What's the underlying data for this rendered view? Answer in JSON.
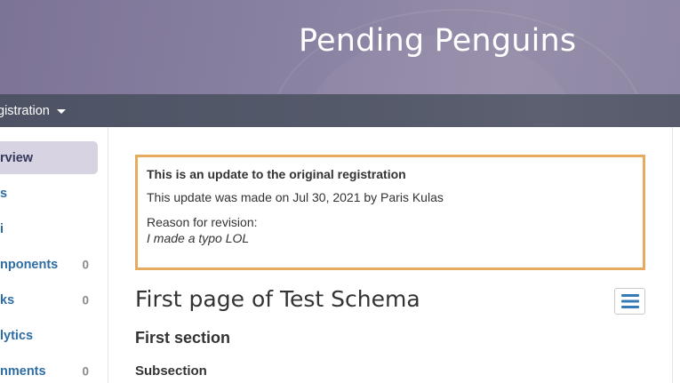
{
  "header": {
    "title": "Pending Penguins"
  },
  "navbar": {
    "dropdown_label": "gistration"
  },
  "sidebar": {
    "items": [
      {
        "label": "rview",
        "count": "",
        "active": true
      },
      {
        "label": "s",
        "count": ""
      },
      {
        "label": "i",
        "count": ""
      },
      {
        "label": "nponents",
        "count": "0"
      },
      {
        "label": "ks",
        "count": "0"
      },
      {
        "label": "lytics",
        "count": ""
      },
      {
        "label": "nments",
        "count": "0"
      }
    ]
  },
  "notice": {
    "title": "This is an update to the original registration",
    "update_info": "This update was made on Jul 30, 2021 by Paris Kulas",
    "reason_label": "Reason for revision:",
    "reason_text": "I made a typo LOL",
    "border_color": "#e6ab5e"
  },
  "main": {
    "page_title": "First page of Test Schema",
    "toc_icon": "list-icon",
    "section_title": "First section",
    "subsection_title": "Subsection"
  },
  "colors": {
    "header_bg": "#8a82a2",
    "navbar_bg": "#555a6b",
    "link": "#2e6da4",
    "active_item_bg": "#d8d3e3"
  }
}
